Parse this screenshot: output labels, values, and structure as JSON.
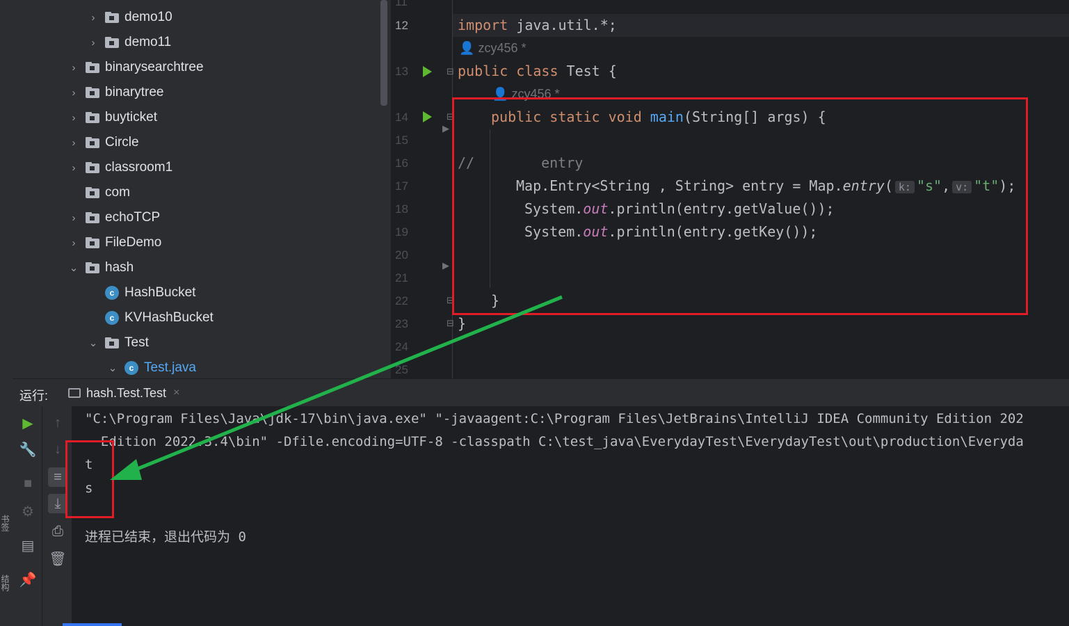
{
  "left_stripe": {
    "top_glyph": "书签",
    "bottom_glyph": "结构"
  },
  "project_tree": {
    "items": [
      {
        "label": "demo10",
        "type": "folder",
        "state": "collapsed",
        "level": 1
      },
      {
        "label": "demo11",
        "type": "folder",
        "state": "collapsed",
        "level": 1
      },
      {
        "label": "binarysearchtree",
        "type": "folder",
        "state": "collapsed",
        "level": 0
      },
      {
        "label": "binarytree",
        "type": "folder",
        "state": "collapsed",
        "level": 0
      },
      {
        "label": "buyticket",
        "type": "folder",
        "state": "collapsed",
        "level": 0
      },
      {
        "label": "Circle",
        "type": "folder",
        "state": "collapsed",
        "level": 0
      },
      {
        "label": "classroom1",
        "type": "folder",
        "state": "collapsed",
        "level": 0
      },
      {
        "label": "com",
        "type": "folder",
        "state": "none",
        "level": 0
      },
      {
        "label": "echoTCP",
        "type": "folder",
        "state": "collapsed",
        "level": 0
      },
      {
        "label": "FileDemo",
        "type": "folder",
        "state": "collapsed",
        "level": 0
      },
      {
        "label": "hash",
        "type": "folder",
        "state": "expanded",
        "level": 0
      },
      {
        "label": "HashBucket",
        "type": "class",
        "state": "none",
        "level": 1
      },
      {
        "label": "KVHashBucket",
        "type": "class",
        "state": "none",
        "level": 1
      },
      {
        "label": "Test",
        "type": "folder",
        "state": "expanded",
        "level": 1
      },
      {
        "label": "Test.java",
        "type": "file",
        "state": "expanded",
        "level": 2
      }
    ]
  },
  "editor": {
    "line_numbers": [
      "11",
      "12",
      "13",
      "14",
      "15",
      "16",
      "17",
      "18",
      "19",
      "20",
      "21",
      "22",
      "23",
      "24",
      "25"
    ],
    "author_hints": [
      "zcy456 *",
      "zcy456 *"
    ],
    "code": {
      "import_kw": "import",
      "import_rest": " java.util.*;",
      "class_kw": "public class",
      "class_rest": " Test {",
      "main_kw": "public static void",
      "main_name": "main",
      "main_rest": "(String[] args) {",
      "comment_mark": "//",
      "comment_text": "entry",
      "entry_decl": "Map.Entry<String , String> entry = Map.",
      "entry_fn": "entry",
      "entry_paren": "(",
      "hint_k": "k:",
      "str_s": "\"s\"",
      "comma": ",",
      "hint_v": "v:",
      "str_t": "\"t\"",
      "entry_end": ");",
      "sys1_pre": "System.",
      "sys_out": "out",
      "sys1_post": ".println(entry.getValue());",
      "sys2_pre": "System.",
      "sys2_post": ".println(entry.getKey());",
      "close_method": "}",
      "close_class": "}"
    }
  },
  "run_panel": {
    "label": "运行:",
    "tab_label": "hash.Test.Test",
    "tab_close": "×",
    "console_lines": [
      "\"C:\\Program Files\\Java\\jdk-17\\bin\\java.exe\" \"-javaagent:C:\\Program Files\\JetBrains\\IntelliJ IDEA Community Edition 202",
      "  Edition 2022.3.4\\bin\" -Dfile.encoding=UTF-8 -classpath C:\\test_java\\EverydayTest\\EverydayTest\\out\\production\\Everyda",
      "t",
      "s",
      "",
      "进程已结束，退出代码为 0"
    ]
  },
  "colors": {
    "annotation_red": "#e01d27",
    "annotation_green": "#22b24c",
    "accent": "#3574f0",
    "run_green": "#5fb832"
  }
}
